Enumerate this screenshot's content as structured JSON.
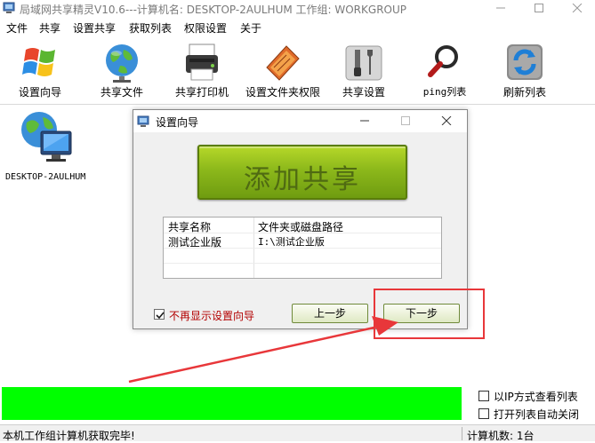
{
  "window": {
    "title": "局域网共享精灵V10.6---计算机名: DESKTOP-2AULHUM  工作组: WORKGROUP"
  },
  "menu": [
    "文件",
    "共享",
    "设置共享",
    "获取列表",
    "权限设置",
    "关于"
  ],
  "toolbar": [
    {
      "label": "设置向导",
      "icon": "windows-logo-icon"
    },
    {
      "label": "共享文件",
      "icon": "globe-icon"
    },
    {
      "label": "共享打印机",
      "icon": "printer-icon"
    },
    {
      "label": "设置文件夹权限",
      "icon": "folder-book-icon"
    },
    {
      "label": "共享设置",
      "icon": "tools-icon"
    },
    {
      "label": "ping列表",
      "icon": "magnifier-icon"
    },
    {
      "label": "刷新列表",
      "icon": "refresh-icon"
    }
  ],
  "computers": [
    {
      "name": "DESKTOP-2AULHUM",
      "icon": "network-computer-icon"
    }
  ],
  "dialog": {
    "title": "设置向导",
    "add_share_label": "添加共享",
    "table": {
      "headers": [
        "共享名称",
        "文件夹或磁盘路径"
      ],
      "rows": [
        [
          "测试企业版",
          "I:\\测试企业版"
        ]
      ]
    },
    "dont_show_label": "不再显示设置向导",
    "dont_show_checked": true,
    "prev_label": "上一步",
    "next_label": "下一步"
  },
  "options": {
    "ip_view_label": "以IP方式查看列表",
    "auto_close_label": "打开列表自动关闭"
  },
  "status": {
    "left_text": "本机工作组计算机获取完毕!",
    "right_text": "计算机数: 1台"
  },
  "colors": {
    "progress": "#00ff00",
    "annotation": "#e8373a",
    "add_share_green": "#8cb81b"
  }
}
